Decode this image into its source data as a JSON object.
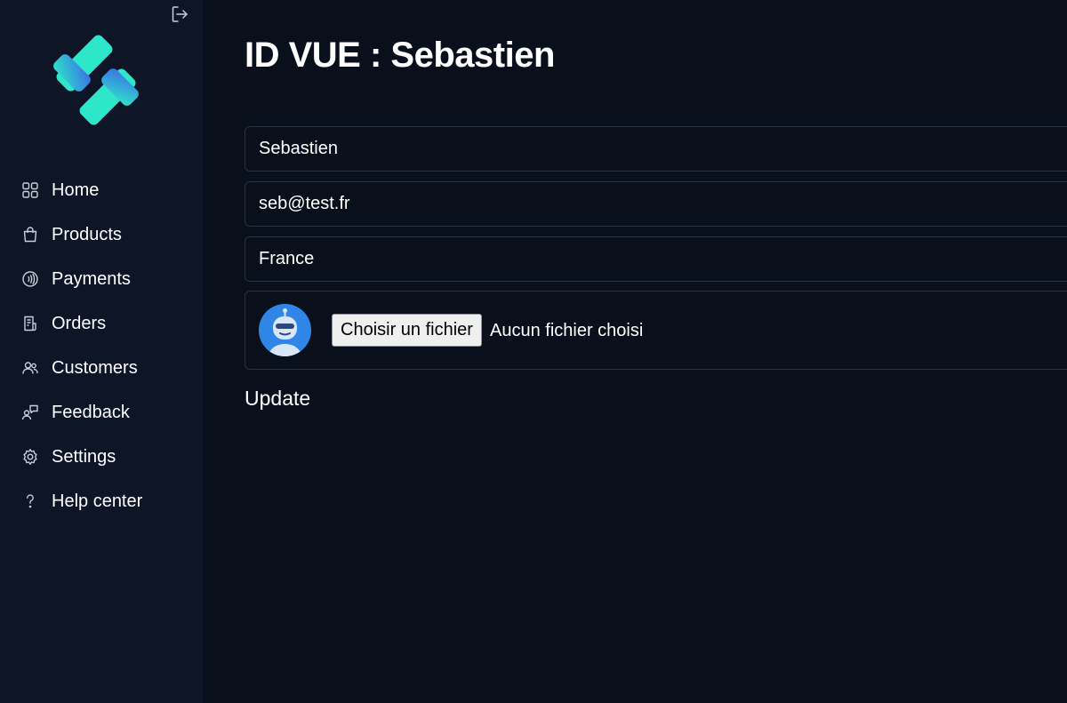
{
  "sidebar": {
    "logout_icon": "logout-icon",
    "logo_icon": "brand-logo",
    "items": [
      {
        "label": "Home",
        "icon": "grid-icon"
      },
      {
        "label": "Products",
        "icon": "shopping-bag-icon"
      },
      {
        "label": "Payments",
        "icon": "contactless-payment-icon"
      },
      {
        "label": "Orders",
        "icon": "receipt-icon"
      },
      {
        "label": "Customers",
        "icon": "users-icon"
      },
      {
        "label": "Feedback",
        "icon": "feedback-icon"
      },
      {
        "label": "Settings",
        "icon": "gear-icon"
      },
      {
        "label": "Help center",
        "icon": "question-icon"
      }
    ]
  },
  "main": {
    "title": "ID VUE : Sebastien",
    "form": {
      "name_value": "Sebastien",
      "email_value": "seb@test.fr",
      "country_value": "France",
      "file_button_label": "Choisir un fichier",
      "file_status": "Aucun fichier choisi",
      "update_label": "Update"
    }
  },
  "colors": {
    "background": "#0a0f1c",
    "sidebar": "#0d1526",
    "border": "#2a3142",
    "avatar": "#2f86e6",
    "logo_teal": "#2ee6c9",
    "logo_blue": "#3b6fe6"
  }
}
